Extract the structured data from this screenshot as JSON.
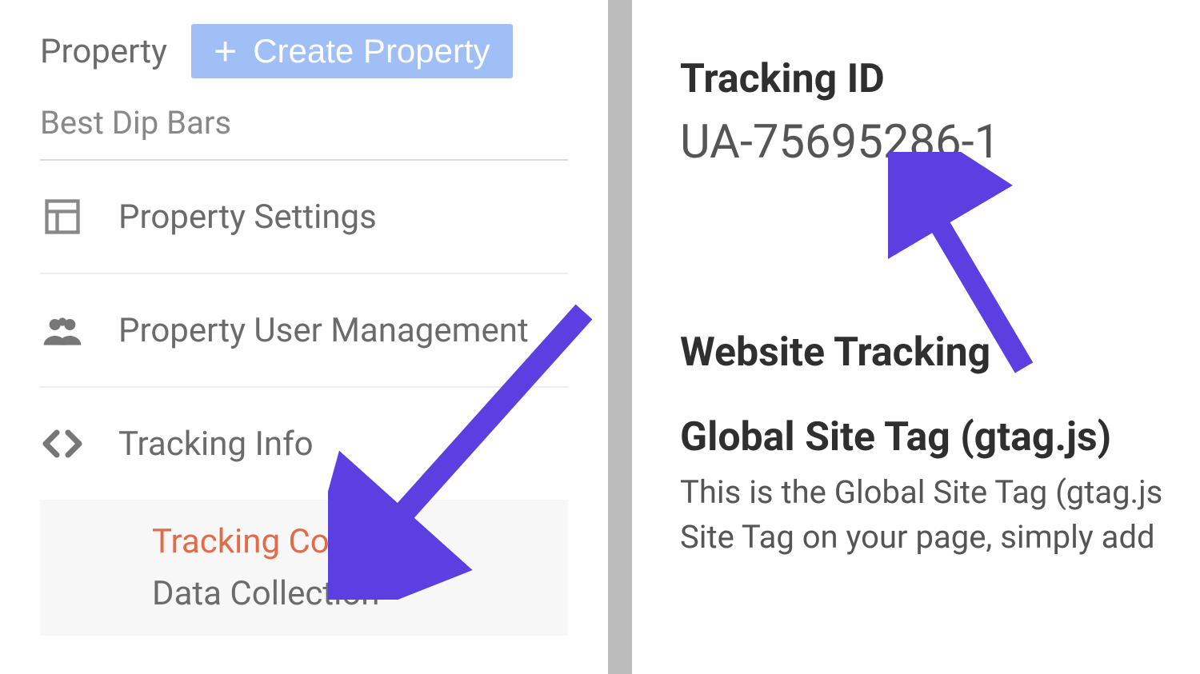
{
  "sidebar": {
    "header_label": "Property",
    "create_button": "Create Property",
    "property_name": "Best Dip Bars",
    "items": [
      {
        "label": "Property Settings"
      },
      {
        "label": "Property User Management"
      },
      {
        "label": "Tracking Info"
      }
    ],
    "tracking_subitems": [
      {
        "label": "Tracking Code",
        "active": true
      },
      {
        "label": "Data Collection",
        "active": false
      }
    ]
  },
  "main": {
    "tracking_id_label": "Tracking ID",
    "tracking_id_value": "UA-75695286-1",
    "website_tracking": "Website Tracking",
    "gtag_title": "Global Site Tag (gtag.js)",
    "gtag_desc_line1": "This is the Global Site Tag (gtag.js",
    "gtag_desc_line2": "Site Tag on your page, simply add"
  },
  "annotations": {
    "arrow_color": "#5b3fe0"
  }
}
